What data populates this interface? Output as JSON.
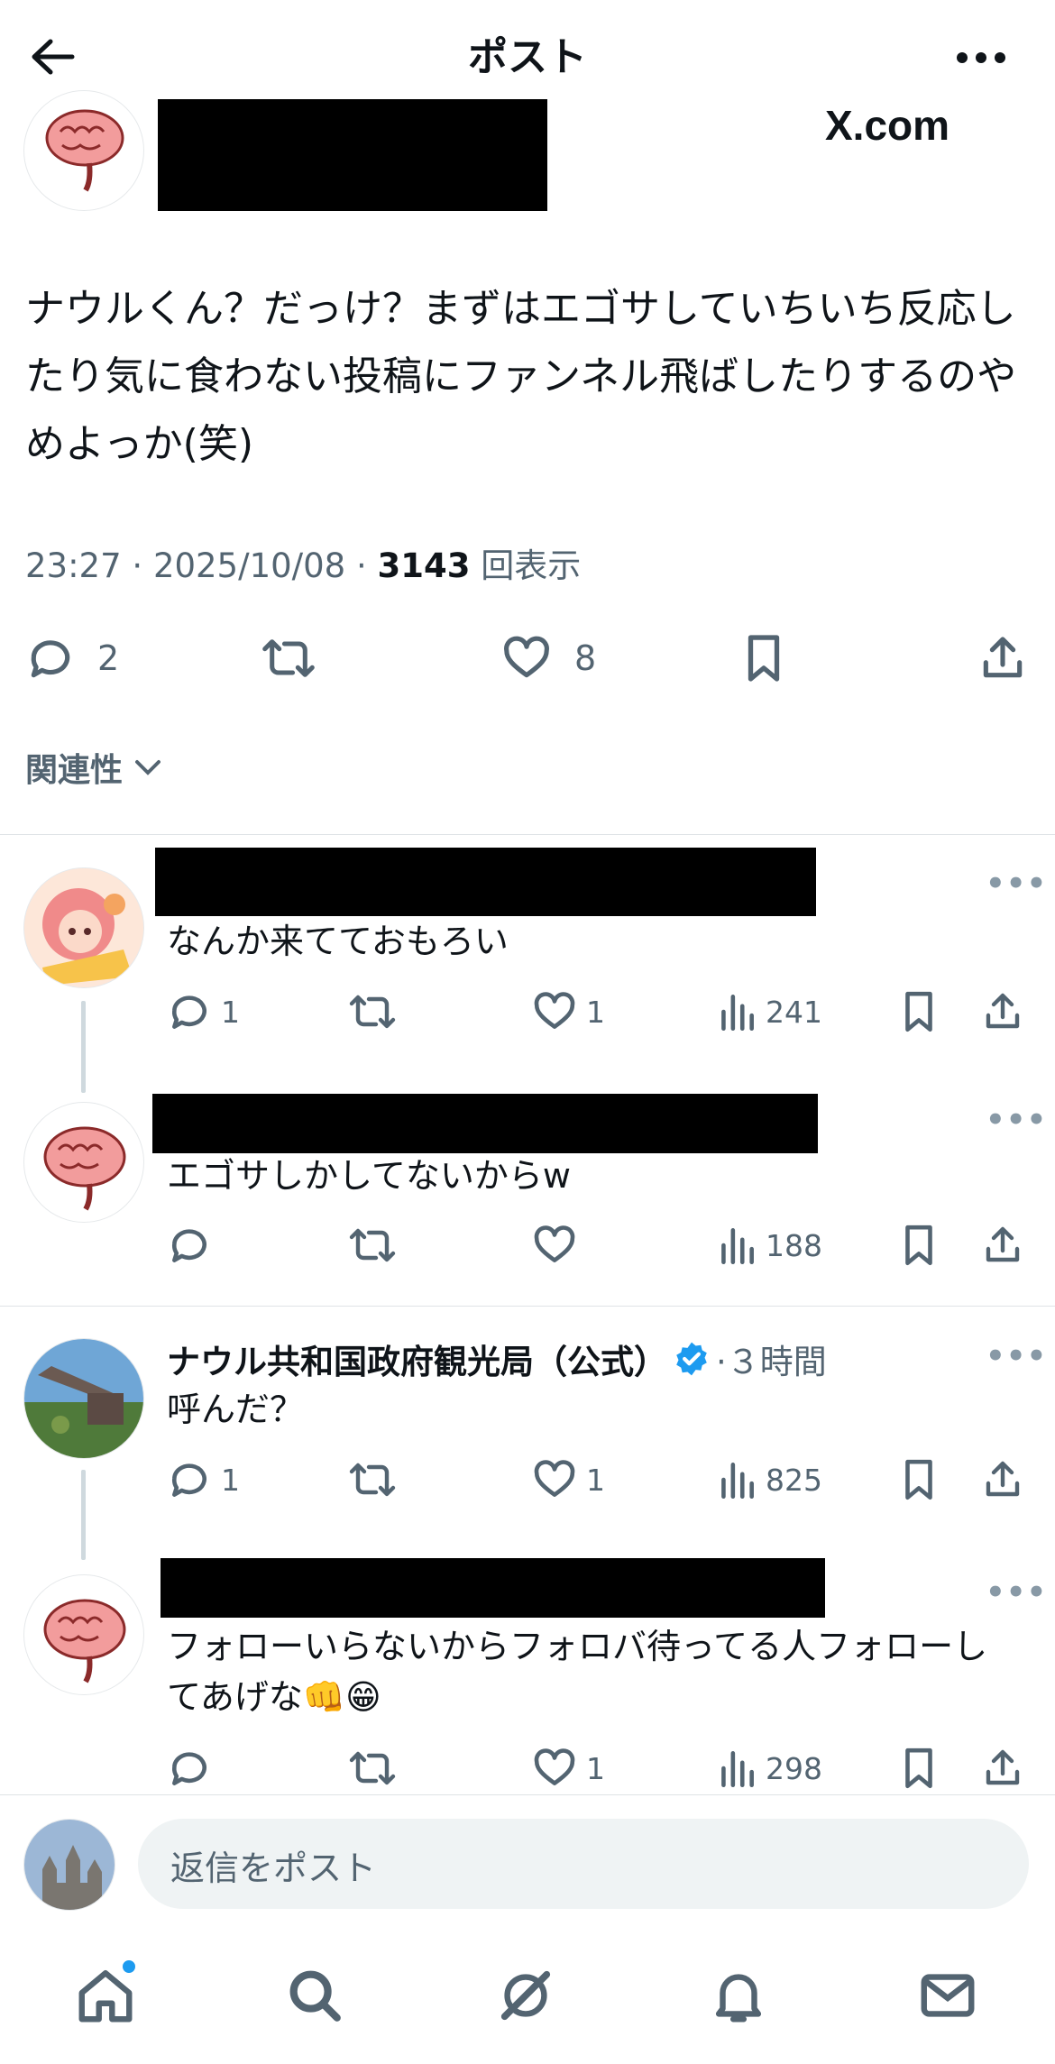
{
  "header": {
    "title": "ポスト",
    "back_icon": "arrow-left-icon",
    "more_icon": "more-dots-icon",
    "watermark": "X.com"
  },
  "post": {
    "text": "ナウルくん？だっけ？まずはエゴサしていちいち反応したり気に食わない投稿にファンネル飛ばしたりするのやめよっか(笑)",
    "time": "23:27",
    "date": "2025/10/08",
    "separator": "·",
    "views": "3143",
    "views_label": "回表示",
    "replies": "2",
    "retweets": "",
    "likes": "8"
  },
  "sort": {
    "label": "関連性"
  },
  "replies": [
    {
      "text": "なんか来てておもろい",
      "replies": "1",
      "retweets": "",
      "likes": "1",
      "views": "241"
    },
    {
      "text": "エゴサしかしてないからw",
      "replies": "",
      "retweets": "",
      "likes": "",
      "views": "188"
    },
    {
      "author": "ナウル共和国政府観光局（公式）",
      "time": "·３時間",
      "verified": true,
      "text": "呼んだ？",
      "replies": "1",
      "retweets": "",
      "likes": "1",
      "views": "825"
    },
    {
      "text": "フォローいらないからフォロバ待ってる人フォローしてあげな👊😁",
      "replies": "",
      "retweets": "",
      "likes": "1",
      "views": "298"
    }
  ],
  "composer": {
    "placeholder": "返信をポスト"
  },
  "tabbar": {
    "items": [
      "home-icon",
      "search-icon",
      "grok-icon",
      "notifications-icon",
      "messages-icon"
    ],
    "home_dot_color": "#1d9bf0"
  },
  "colors": {
    "accent": "#1d9bf0",
    "muted": "#536471",
    "text": "#0f1419"
  }
}
